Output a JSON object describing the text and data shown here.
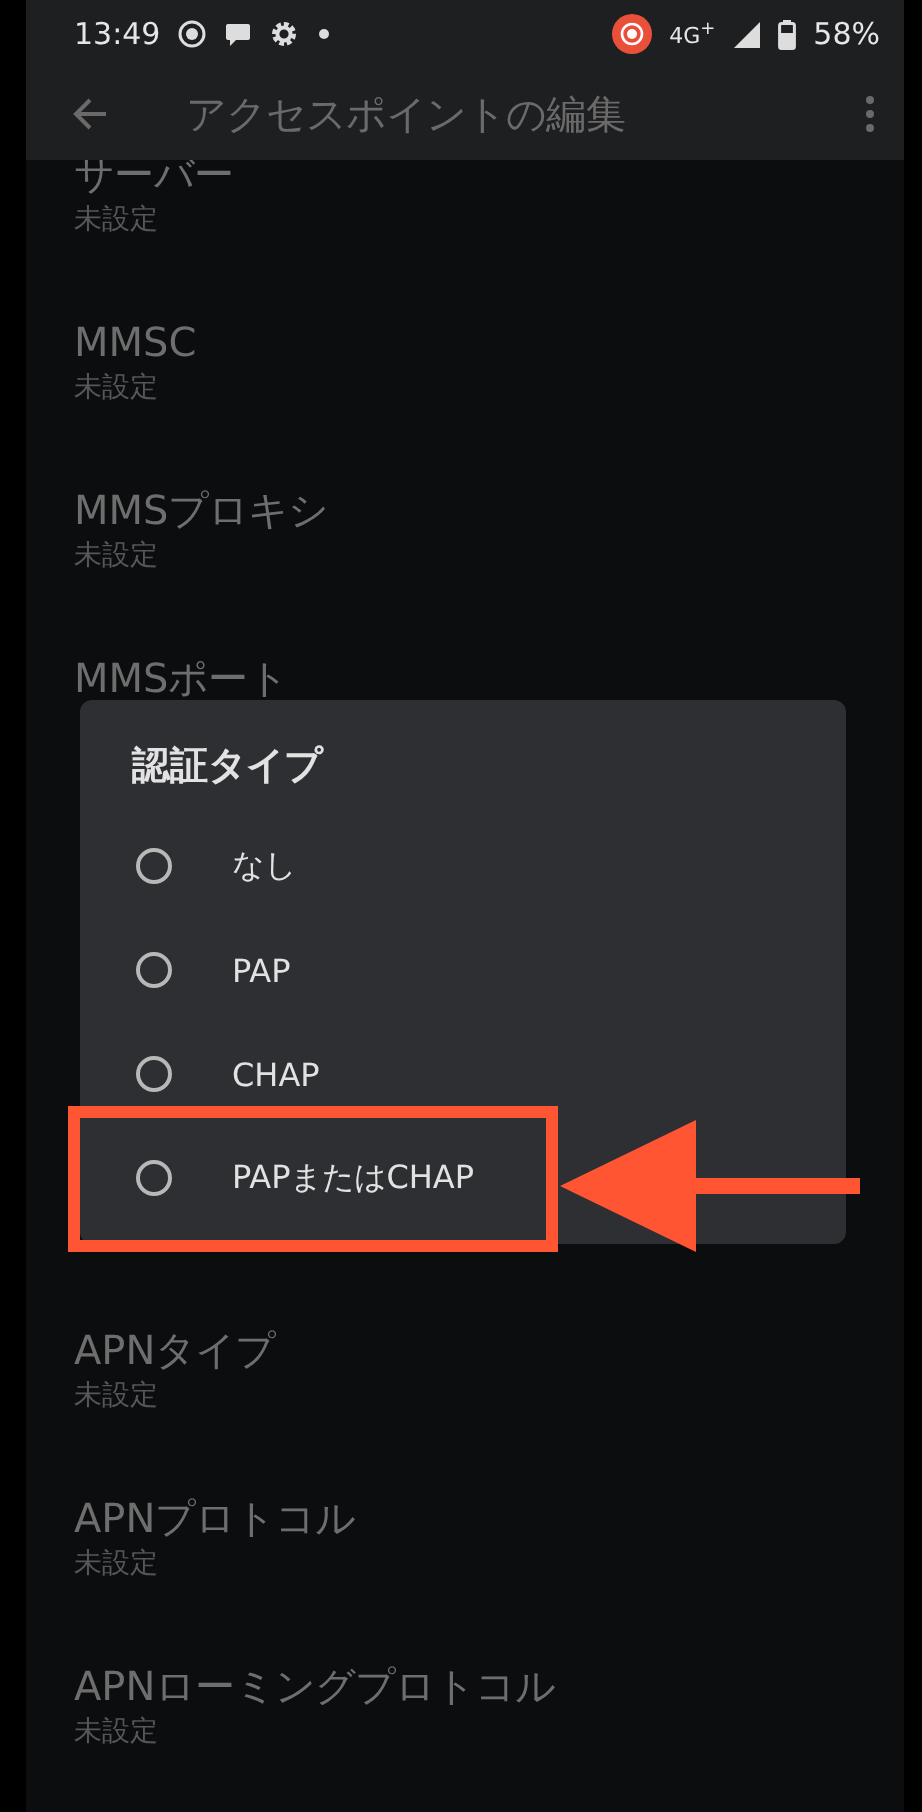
{
  "status_bar": {
    "time": "13:49",
    "network": "4G$^{+}$",
    "battery": "58%"
  },
  "app_bar": {
    "title": "アクセスポイントの編集"
  },
  "settings_above": [
    {
      "title": "サーバー",
      "value": "未設定"
    },
    {
      "title": "MMSC",
      "value": "未設定"
    },
    {
      "title": "MMSプロキシ",
      "value": "未設定"
    },
    {
      "title": "MMSポート"
    }
  ],
  "settings_below": [
    {
      "title": "APNタイプ",
      "value": "未設定"
    },
    {
      "title": "APNプロトコル",
      "value": "未設定"
    },
    {
      "title": "APNローミングプロトコル",
      "value": "未設定"
    }
  ],
  "dialog": {
    "title": "認証タイプ",
    "options": [
      {
        "label": "なし",
        "selected": false,
        "highlighted": false
      },
      {
        "label": "PAP",
        "selected": false,
        "highlighted": false
      },
      {
        "label": "CHAP",
        "selected": false,
        "highlighted": false
      },
      {
        "label": "PAPまたはCHAP",
        "selected": false,
        "highlighted": true
      }
    ]
  }
}
